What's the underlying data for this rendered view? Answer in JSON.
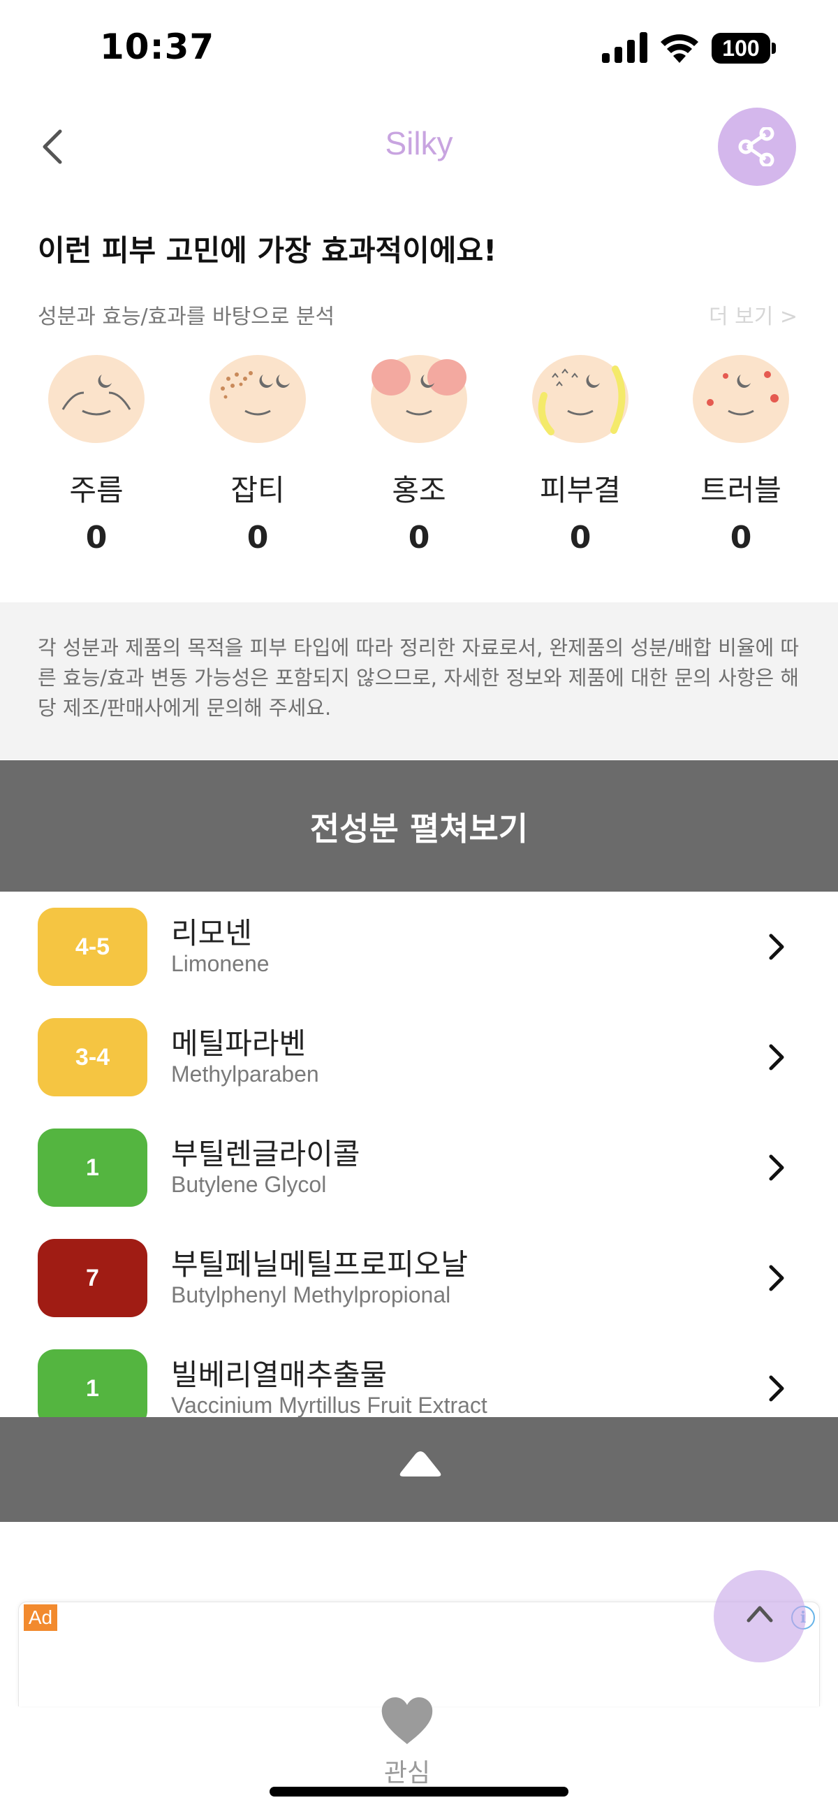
{
  "status_bar": {
    "time": "10:37",
    "battery": "100"
  },
  "header": {
    "title": "Silky",
    "back_icon": "chevron-left-icon",
    "share_icon": "share-icon",
    "accent": "#c8a4e0"
  },
  "concerns": {
    "heading": "이런 피부 고민에 가장 효과적이에요!",
    "subheading": "성분과 효능/효과를 바탕으로 분석",
    "more": "더 보기 >",
    "items": [
      {
        "label": "주름",
        "count": "0",
        "icon": "wrinkle-face-icon"
      },
      {
        "label": "잡티",
        "count": "0",
        "icon": "blemish-face-icon"
      },
      {
        "label": "홍조",
        "count": "0",
        "icon": "redness-face-icon"
      },
      {
        "label": "피부결",
        "count": "0",
        "icon": "texture-face-icon"
      },
      {
        "label": "트러블",
        "count": "0",
        "icon": "trouble-face-icon"
      }
    ]
  },
  "disclaimer": "각 성분과 제품의 목적을 피부 타입에 따라 정리한 자료로서, 완제품의 성분/배합 비율에 따른 효능/효과 변동 가능성은 포함되지 않으므로, 자세한 정보와 제품에 대한 문의 사항은 해당 제조/판매사에게 문의해 주세요.",
  "expand_label": "전성분 펼쳐보기",
  "ingredients": [
    {
      "grade": "4-5",
      "name_kr": "리모넨",
      "name_en": "Limonene",
      "color": "#f5c542"
    },
    {
      "grade": "3-4",
      "name_kr": "메틸파라벤",
      "name_en": "Methylparaben",
      "color": "#f5c542"
    },
    {
      "grade": "1",
      "name_kr": "부틸렌글라이콜",
      "name_en": "Butylene Glycol",
      "color": "#54b540"
    },
    {
      "grade": "7",
      "name_kr": "부틸페닐메틸프로피오날",
      "name_en": "Butylphenyl Methylpropional",
      "color": "#a01c14"
    },
    {
      "grade": "1",
      "name_kr": "빌베리열매추출물",
      "name_en": "Vaccinium Myrtillus Fruit Extract",
      "color": "#54b540"
    }
  ],
  "ad": {
    "badge": "Ad",
    "info": "i"
  },
  "bottom": {
    "favorite_label": "관심",
    "favorite_icon": "heart-icon"
  }
}
